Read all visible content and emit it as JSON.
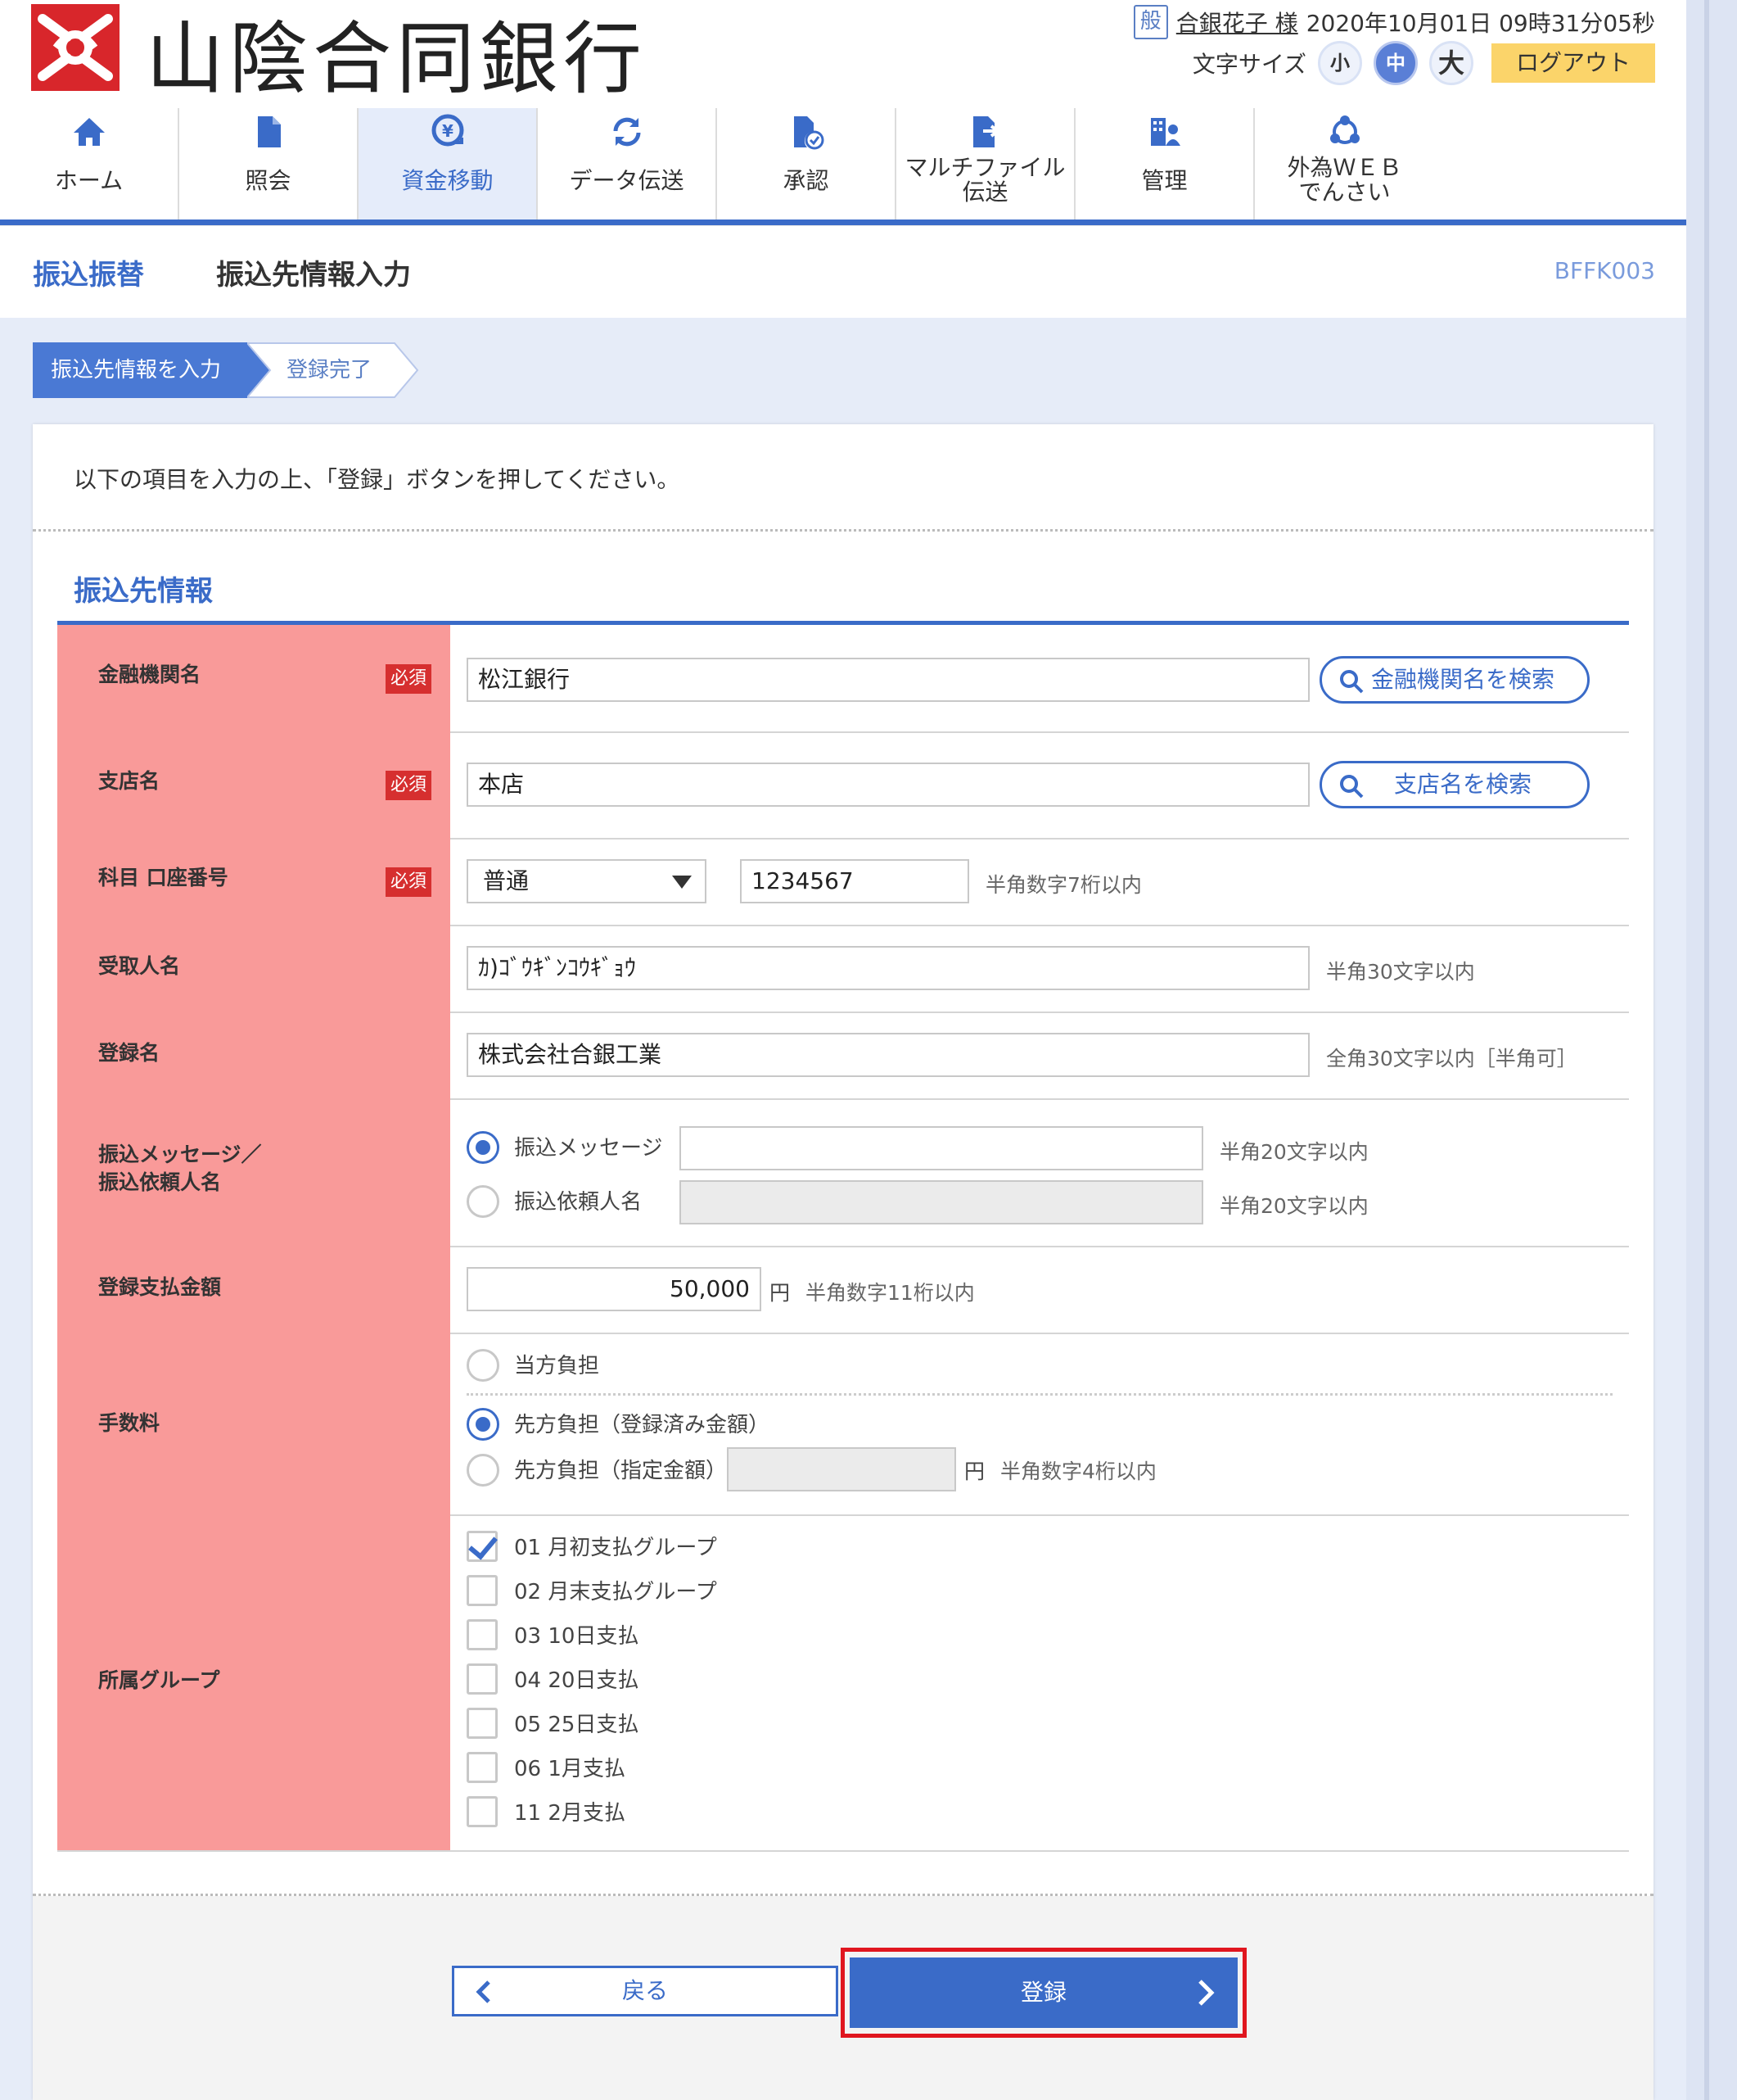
{
  "header": {
    "bank_name": "山陰合同銀行",
    "user_badge": "般",
    "user_name": "合銀花子 様",
    "datetime": "2020年10月01日 09時31分05秒",
    "font_size_label": "文字サイズ",
    "font_sizes": [
      "小",
      "中",
      "大"
    ],
    "logout_label": "ログアウト"
  },
  "nav": {
    "items": [
      {
        "label": "ホーム",
        "icon": "home-icon"
      },
      {
        "label": "照会",
        "icon": "document-icon"
      },
      {
        "label": "資金移動",
        "icon": "yen-transfer-icon"
      },
      {
        "label": "データ伝送",
        "icon": "refresh-icon"
      },
      {
        "label": "承認",
        "icon": "approve-icon"
      },
      {
        "label": "マルチファイル伝送",
        "label_line1": "マルチファイル",
        "label_line2": "伝送",
        "icon": "file-send-icon"
      },
      {
        "label": "管理",
        "icon": "admin-icon"
      },
      {
        "label": "外為ＷＥＢでんさい",
        "label_line1": "外為ＷＥＢ",
        "label_line2": "でんさい",
        "icon": "network-icon"
      }
    ],
    "active_index": 2
  },
  "titlebar": {
    "category": "振込振替",
    "title": "振込先情報入力",
    "screen_code": "BFFK003"
  },
  "steps": [
    "振込先情報を入力",
    "登録完了"
  ],
  "intro": "以下の項目を入力の上、「登録」ボタンを押してください。",
  "section_title": "振込先情報",
  "required_label": "必須",
  "form": {
    "bank": {
      "label": "金融機関名",
      "value": "松江銀行",
      "search_label": "金融機関名を検索"
    },
    "branch": {
      "label": "支店名",
      "value": "本店",
      "search_label": "支店名を検索"
    },
    "account": {
      "label": "科目 口座番号",
      "type_value": "普通",
      "number_value": "1234567",
      "hint": "半角数字7桁以内"
    },
    "payee": {
      "label": "受取人名",
      "value": "ｶ)ｺﾞｳｷﾞﾝｺｳｷﾞｮｳ",
      "hint": "半角30文字以内"
    },
    "reg_name": {
      "label": "登録名",
      "value": "株式会社合銀工業",
      "hint": "全角30文字以内［半角可］"
    },
    "message": {
      "label_line1": "振込メッセージ／",
      "label_line2": "振込依頼人名",
      "opt1": "振込メッセージ",
      "opt2": "振込依頼人名",
      "hint1": "半角20文字以内",
      "hint2": "半角20文字以内",
      "selected": 0
    },
    "amount": {
      "label": "登録支払金額",
      "value": "50,000",
      "unit": "円",
      "hint": "半角数字11桁以内"
    },
    "fee": {
      "label": "手数料",
      "opt1": "当方負担",
      "opt2": "先方負担（登録済み金額）",
      "opt3": "先方負担（指定金額）",
      "unit": "円",
      "hint": "半角数字4桁以内",
      "selected": 1
    },
    "groups": {
      "label": "所属グループ",
      "items": [
        {
          "label": "01 月初支払グループ",
          "checked": true
        },
        {
          "label": "02 月末支払グループ",
          "checked": false
        },
        {
          "label": "03 10日支払",
          "checked": false
        },
        {
          "label": "04 20日支払",
          "checked": false
        },
        {
          "label": "05 25日支払",
          "checked": false
        },
        {
          "label": "06 1月支払",
          "checked": false
        },
        {
          "label": "11 2月支払",
          "checked": false
        }
      ]
    }
  },
  "buttons": {
    "back": "戻る",
    "register": "登録"
  },
  "colors": {
    "accent": "#3a6bc8",
    "header_cell": "#f99a99",
    "required": "#d62f2f",
    "highlight_frame": "#e0161f",
    "logout": "#fbd46a"
  }
}
